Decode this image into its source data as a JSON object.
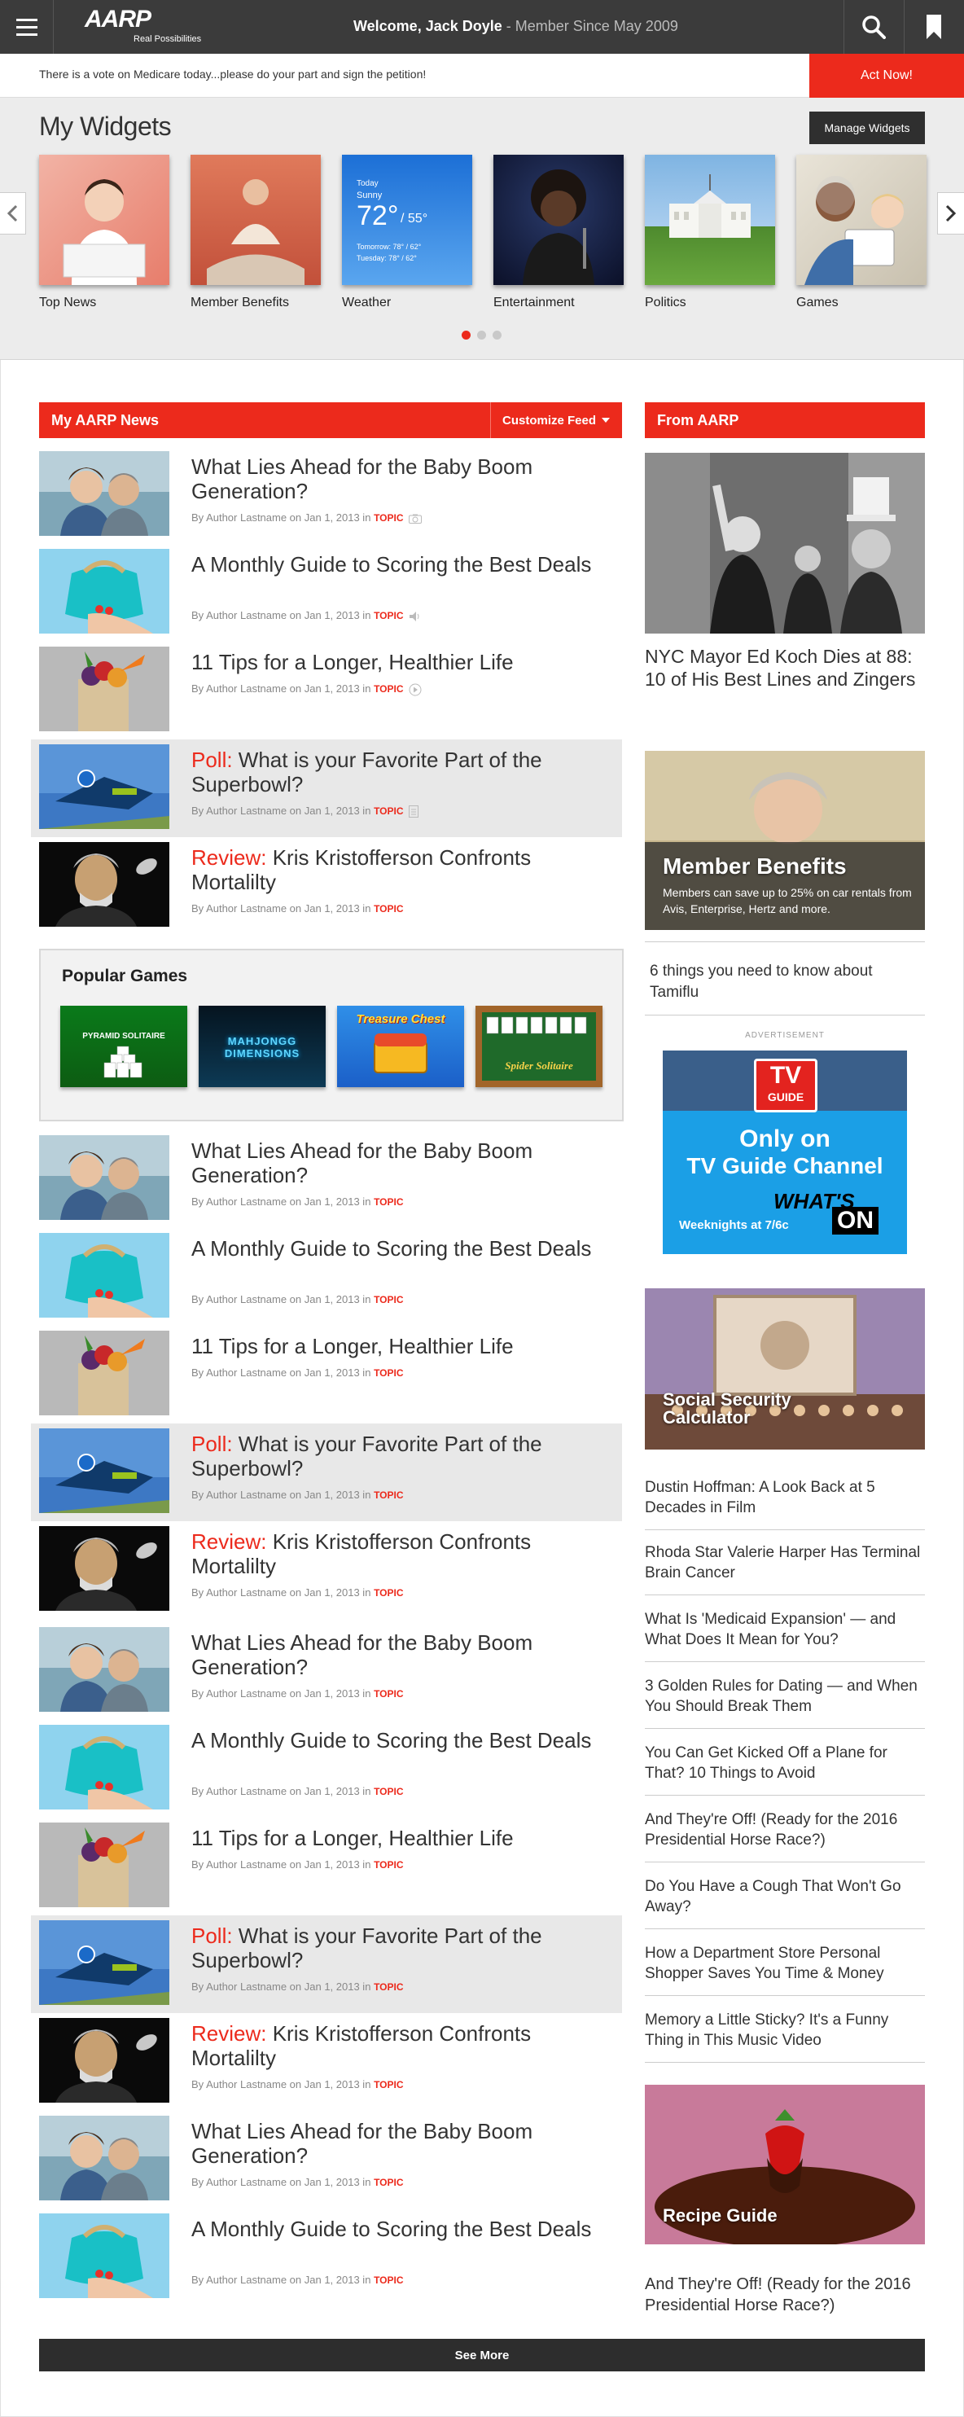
{
  "header": {
    "logo": "AARP",
    "tagline": "Real Possibilities",
    "welcome": "Welcome, Jack Doyle",
    "member_since": " - Member Since May 2009"
  },
  "alert": {
    "text": "There is a vote on Medicare today...please do your part and sign the petition!",
    "action": "Act Now!"
  },
  "widgets": {
    "title": "My Widgets",
    "manage_label": "Manage Widgets",
    "items": [
      {
        "label": "Top News"
      },
      {
        "label": "Member Benefits"
      },
      {
        "label": "Weather"
      },
      {
        "label": "Entertainment"
      },
      {
        "label": "Politics"
      },
      {
        "label": "Games"
      }
    ],
    "weather": {
      "today": "Today",
      "condition": "Sunny",
      "temp": "72°",
      "low": "/ 55°",
      "tomorrow": "Tomorrow: 78° / 62°",
      "tuesday": "Tuesday: 78° / 62°"
    },
    "carousel_pages": 3,
    "active_page": 1
  },
  "news": {
    "title": "My AARP News",
    "customize_label": "Customize Feed",
    "meta": "By Author Lastname on Jan 1, 2013 in",
    "topic": "TOPIC",
    "articles": [
      {
        "prefix": "",
        "title": "What Lies Ahead for the Baby Boom Generation?",
        "media": "camera"
      },
      {
        "prefix": "",
        "title": "A Monthly Guide to Scoring the Best Deals",
        "media": "audio"
      },
      {
        "prefix": "",
        "title": "11 Tips for a Longer, Healthier Life",
        "media": "video"
      },
      {
        "prefix": "Poll:",
        "title": " What is your Favorite Part of the Superbowl?",
        "media": "doc"
      },
      {
        "prefix": "Review:",
        "title": " Kris Kristofferson Confronts Mortalilty",
        "media": ""
      },
      {
        "prefix": "",
        "title": "What Lies Ahead for the Baby Boom Generation?",
        "media": ""
      },
      {
        "prefix": "",
        "title": "A Monthly Guide to Scoring the Best Deals",
        "media": ""
      },
      {
        "prefix": "",
        "title": "11 Tips for a Longer, Healthier Life",
        "media": ""
      },
      {
        "prefix": "Poll:",
        "title": " What is your Favorite Part of the Superbowl?",
        "media": ""
      },
      {
        "prefix": "Review:",
        "title": " Kris Kristofferson Confronts Mortalilty",
        "media": ""
      },
      {
        "prefix": "",
        "title": "What Lies Ahead for the Baby Boom Generation?",
        "media": ""
      },
      {
        "prefix": "",
        "title": "A Monthly Guide to Scoring the Best Deals",
        "media": ""
      },
      {
        "prefix": "",
        "title": "11 Tips for a Longer, Healthier Life",
        "media": ""
      },
      {
        "prefix": "Poll:",
        "title": " What is your Favorite Part of the Superbowl?",
        "media": ""
      },
      {
        "prefix": "Review:",
        "title": " Kris Kristofferson Confronts Mortalilty",
        "media": ""
      },
      {
        "prefix": "",
        "title": "What Lies Ahead for the Baby Boom Generation?",
        "media": ""
      },
      {
        "prefix": "",
        "title": "A Monthly Guide to Scoring the Best Deals",
        "media": ""
      }
    ]
  },
  "games": {
    "title": "Popular Games",
    "items": [
      {
        "name": "PYRAMID SOLITAIRE"
      },
      {
        "name": "MAHJONGG DIMENSIONS"
      },
      {
        "name": "Treasure Chest"
      },
      {
        "name": "Spider Solitaire"
      }
    ]
  },
  "sidebar": {
    "title": "From AARP",
    "feature_caption": "NYC Mayor Ed Koch Dies at 88: 10 of His Best Lines and Zingers",
    "benefits_title": "Member Benefits",
    "benefits_text": "Members can save up to 25% on car rentals from Avis, Enterprise, Hertz and more.",
    "tamiflu": "6 things you need to know about Tamiflu",
    "ad_label": "ADVERTISEMENT",
    "ad": {
      "logo_top": "TV",
      "logo_bottom": "GUIDE",
      "line1": "Only on",
      "line2": "TV Guide Channel",
      "whats": "WHAT'S",
      "on": "ON",
      "time": "Weeknights at 7/6c"
    },
    "ss_title": "Social Security Calculator",
    "links": [
      "Dustin Hoffman: A Look Back at 5 Decades in Film",
      "Rhoda Star Valerie Harper Has Terminal Brain Cancer",
      "What Is 'Medicaid Expansion' — and What Does It Mean for You?",
      "3 Golden Rules for Dating — and When You Should Break Them",
      "You Can Get Kicked Off a Plane for That? 10 Things to Avoid",
      "And They're Off! (Ready for the 2016 Presidential Horse Race?)",
      "Do You Have a Cough That Won't Go Away?",
      "How a Department Store Personal Shopper Saves You Time & Money",
      "Memory a Little Sticky? It's a Funny Thing in This Music Video"
    ],
    "recipe_title": "Recipe Guide",
    "last_link": "And They're Off! (Ready for the 2016 Presidential Horse Race?)"
  },
  "footer": {
    "see_more": "See More"
  }
}
